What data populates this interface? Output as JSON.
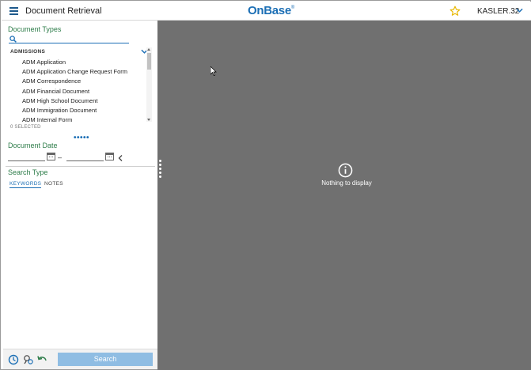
{
  "header": {
    "title": "Document Retrieval",
    "logo_text": "OnBase",
    "logo_mark": "®",
    "user": "KASLER.32",
    "icons": {
      "menu": "hamburger-menu-icon",
      "favorite": "star-icon",
      "user_menu": "chevron-down-icon"
    }
  },
  "document_types": {
    "title": "Document Types",
    "search_placeholder": "",
    "category": "ADMISSIONS",
    "items": [
      "ADM Application",
      "ADM Application Change Request Form",
      "ADM Correspondence",
      "ADM Financial Document",
      "ADM High School Document",
      "ADM Immigration Document",
      "ADM Internal Form"
    ],
    "selected_count": "0 SELECTED"
  },
  "document_date": {
    "title": "Document Date",
    "from_value": "",
    "to_value": "",
    "separator": "–"
  },
  "search_type": {
    "title": "Search Type",
    "tabs": [
      {
        "label": "KEYWORDS",
        "active": true
      },
      {
        "label": "NOTES",
        "active": false
      }
    ]
  },
  "bottom_bar": {
    "search_button": "Search",
    "icons": [
      "history-icon",
      "query-settings-icon",
      "undo-icon"
    ]
  },
  "main": {
    "empty_message": "Nothing to display"
  },
  "colors": {
    "accent": "#1c6fb5",
    "section_title": "#2e7d4a",
    "main_background": "#707070",
    "search_button": "#8fbde3",
    "star": "#e8b800"
  }
}
